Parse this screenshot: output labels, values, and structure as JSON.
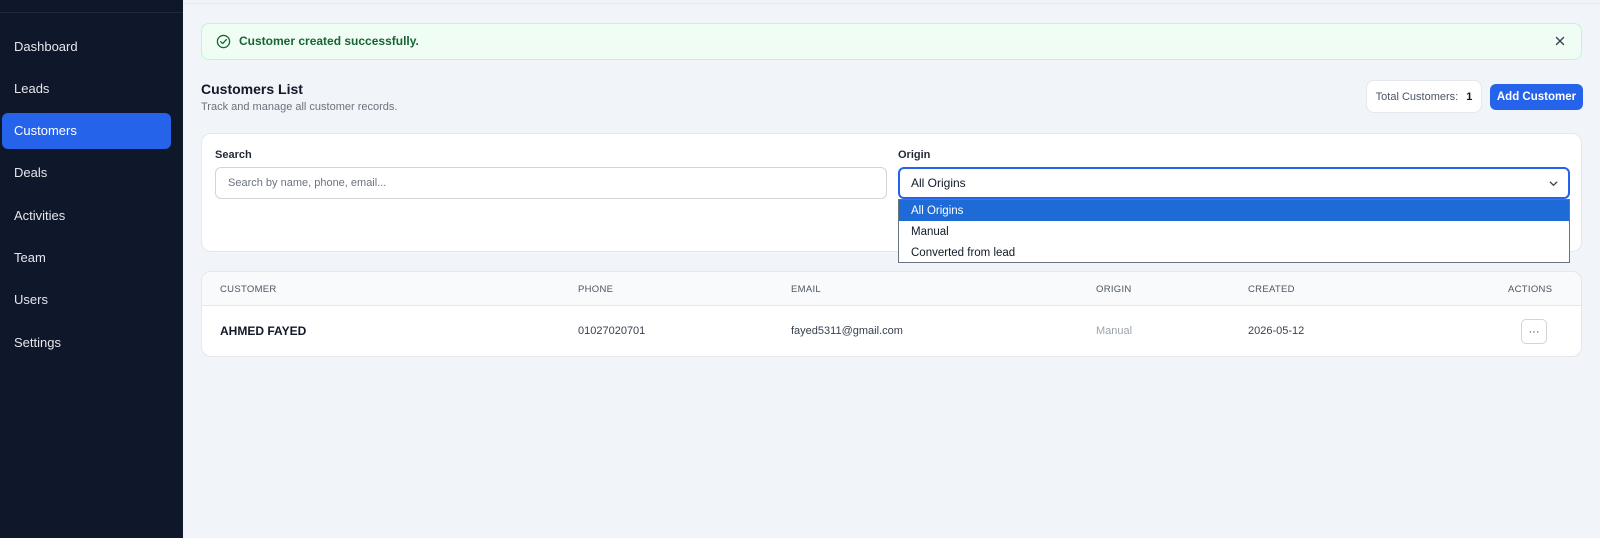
{
  "sidebar": {
    "items": [
      {
        "label": "Dashboard"
      },
      {
        "label": "Leads"
      },
      {
        "label": "Customers",
        "active": true
      },
      {
        "label": "Deals"
      },
      {
        "label": "Activities"
      },
      {
        "label": "Team"
      },
      {
        "label": "Users"
      },
      {
        "label": "Settings"
      }
    ]
  },
  "alert": {
    "message": "Customer created successfully.",
    "icon": "check-circle-icon",
    "close_icon": "close-icon"
  },
  "header": {
    "title": "Customers List",
    "subtitle": "Track and manage all customer records.",
    "total_label": "Total Customers:",
    "total_count": "1",
    "add_button": "Add Customer"
  },
  "filters": {
    "search_label": "Search",
    "search_placeholder": "Search by name, phone, email...",
    "origin_label": "Origin",
    "origin_selected": "All Origins",
    "origin_options": [
      "All Origins",
      "Manual",
      "Converted from lead"
    ]
  },
  "table": {
    "columns": [
      "CUSTOMER",
      "PHONE",
      "EMAIL",
      "ORIGIN",
      "CREATED",
      "ACTIONS"
    ],
    "rows": [
      {
        "customer": "AHMED FAYED",
        "phone": "01027020701",
        "email": "fayed5311@gmail.com",
        "origin": "Manual",
        "created": "2026-05-12",
        "action": "···"
      }
    ]
  },
  "colors": {
    "sidebar_bg": "#0f172a",
    "accent": "#2563eb",
    "success_bg": "#f0fdf4",
    "success_text": "#166534"
  }
}
